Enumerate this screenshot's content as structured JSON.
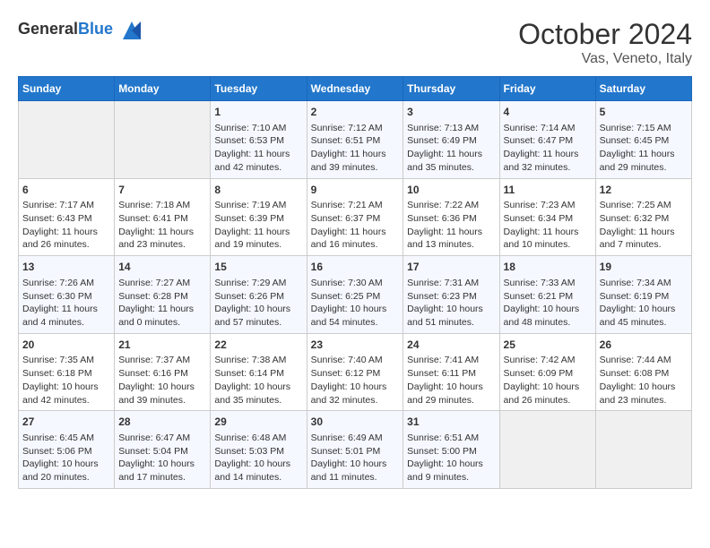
{
  "header": {
    "logo_general": "General",
    "logo_blue": "Blue",
    "month": "October 2024",
    "location": "Vas, Veneto, Italy"
  },
  "weekdays": [
    "Sunday",
    "Monday",
    "Tuesday",
    "Wednesday",
    "Thursday",
    "Friday",
    "Saturday"
  ],
  "weeks": [
    [
      {
        "day": "",
        "sunrise": "",
        "sunset": "",
        "daylight": ""
      },
      {
        "day": "",
        "sunrise": "",
        "sunset": "",
        "daylight": ""
      },
      {
        "day": "1",
        "sunrise": "Sunrise: 7:10 AM",
        "sunset": "Sunset: 6:53 PM",
        "daylight": "Daylight: 11 hours and 42 minutes."
      },
      {
        "day": "2",
        "sunrise": "Sunrise: 7:12 AM",
        "sunset": "Sunset: 6:51 PM",
        "daylight": "Daylight: 11 hours and 39 minutes."
      },
      {
        "day": "3",
        "sunrise": "Sunrise: 7:13 AM",
        "sunset": "Sunset: 6:49 PM",
        "daylight": "Daylight: 11 hours and 35 minutes."
      },
      {
        "day": "4",
        "sunrise": "Sunrise: 7:14 AM",
        "sunset": "Sunset: 6:47 PM",
        "daylight": "Daylight: 11 hours and 32 minutes."
      },
      {
        "day": "5",
        "sunrise": "Sunrise: 7:15 AM",
        "sunset": "Sunset: 6:45 PM",
        "daylight": "Daylight: 11 hours and 29 minutes."
      }
    ],
    [
      {
        "day": "6",
        "sunrise": "Sunrise: 7:17 AM",
        "sunset": "Sunset: 6:43 PM",
        "daylight": "Daylight: 11 hours and 26 minutes."
      },
      {
        "day": "7",
        "sunrise": "Sunrise: 7:18 AM",
        "sunset": "Sunset: 6:41 PM",
        "daylight": "Daylight: 11 hours and 23 minutes."
      },
      {
        "day": "8",
        "sunrise": "Sunrise: 7:19 AM",
        "sunset": "Sunset: 6:39 PM",
        "daylight": "Daylight: 11 hours and 19 minutes."
      },
      {
        "day": "9",
        "sunrise": "Sunrise: 7:21 AM",
        "sunset": "Sunset: 6:37 PM",
        "daylight": "Daylight: 11 hours and 16 minutes."
      },
      {
        "day": "10",
        "sunrise": "Sunrise: 7:22 AM",
        "sunset": "Sunset: 6:36 PM",
        "daylight": "Daylight: 11 hours and 13 minutes."
      },
      {
        "day": "11",
        "sunrise": "Sunrise: 7:23 AM",
        "sunset": "Sunset: 6:34 PM",
        "daylight": "Daylight: 11 hours and 10 minutes."
      },
      {
        "day": "12",
        "sunrise": "Sunrise: 7:25 AM",
        "sunset": "Sunset: 6:32 PM",
        "daylight": "Daylight: 11 hours and 7 minutes."
      }
    ],
    [
      {
        "day": "13",
        "sunrise": "Sunrise: 7:26 AM",
        "sunset": "Sunset: 6:30 PM",
        "daylight": "Daylight: 11 hours and 4 minutes."
      },
      {
        "day": "14",
        "sunrise": "Sunrise: 7:27 AM",
        "sunset": "Sunset: 6:28 PM",
        "daylight": "Daylight: 11 hours and 0 minutes."
      },
      {
        "day": "15",
        "sunrise": "Sunrise: 7:29 AM",
        "sunset": "Sunset: 6:26 PM",
        "daylight": "Daylight: 10 hours and 57 minutes."
      },
      {
        "day": "16",
        "sunrise": "Sunrise: 7:30 AM",
        "sunset": "Sunset: 6:25 PM",
        "daylight": "Daylight: 10 hours and 54 minutes."
      },
      {
        "day": "17",
        "sunrise": "Sunrise: 7:31 AM",
        "sunset": "Sunset: 6:23 PM",
        "daylight": "Daylight: 10 hours and 51 minutes."
      },
      {
        "day": "18",
        "sunrise": "Sunrise: 7:33 AM",
        "sunset": "Sunset: 6:21 PM",
        "daylight": "Daylight: 10 hours and 48 minutes."
      },
      {
        "day": "19",
        "sunrise": "Sunrise: 7:34 AM",
        "sunset": "Sunset: 6:19 PM",
        "daylight": "Daylight: 10 hours and 45 minutes."
      }
    ],
    [
      {
        "day": "20",
        "sunrise": "Sunrise: 7:35 AM",
        "sunset": "Sunset: 6:18 PM",
        "daylight": "Daylight: 10 hours and 42 minutes."
      },
      {
        "day": "21",
        "sunrise": "Sunrise: 7:37 AM",
        "sunset": "Sunset: 6:16 PM",
        "daylight": "Daylight: 10 hours and 39 minutes."
      },
      {
        "day": "22",
        "sunrise": "Sunrise: 7:38 AM",
        "sunset": "Sunset: 6:14 PM",
        "daylight": "Daylight: 10 hours and 35 minutes."
      },
      {
        "day": "23",
        "sunrise": "Sunrise: 7:40 AM",
        "sunset": "Sunset: 6:12 PM",
        "daylight": "Daylight: 10 hours and 32 minutes."
      },
      {
        "day": "24",
        "sunrise": "Sunrise: 7:41 AM",
        "sunset": "Sunset: 6:11 PM",
        "daylight": "Daylight: 10 hours and 29 minutes."
      },
      {
        "day": "25",
        "sunrise": "Sunrise: 7:42 AM",
        "sunset": "Sunset: 6:09 PM",
        "daylight": "Daylight: 10 hours and 26 minutes."
      },
      {
        "day": "26",
        "sunrise": "Sunrise: 7:44 AM",
        "sunset": "Sunset: 6:08 PM",
        "daylight": "Daylight: 10 hours and 23 minutes."
      }
    ],
    [
      {
        "day": "27",
        "sunrise": "Sunrise: 6:45 AM",
        "sunset": "Sunset: 5:06 PM",
        "daylight": "Daylight: 10 hours and 20 minutes."
      },
      {
        "day": "28",
        "sunrise": "Sunrise: 6:47 AM",
        "sunset": "Sunset: 5:04 PM",
        "daylight": "Daylight: 10 hours and 17 minutes."
      },
      {
        "day": "29",
        "sunrise": "Sunrise: 6:48 AM",
        "sunset": "Sunset: 5:03 PM",
        "daylight": "Daylight: 10 hours and 14 minutes."
      },
      {
        "day": "30",
        "sunrise": "Sunrise: 6:49 AM",
        "sunset": "Sunset: 5:01 PM",
        "daylight": "Daylight: 10 hours and 11 minutes."
      },
      {
        "day": "31",
        "sunrise": "Sunrise: 6:51 AM",
        "sunset": "Sunset: 5:00 PM",
        "daylight": "Daylight: 10 hours and 9 minutes."
      },
      {
        "day": "",
        "sunrise": "",
        "sunset": "",
        "daylight": ""
      },
      {
        "day": "",
        "sunrise": "",
        "sunset": "",
        "daylight": ""
      }
    ]
  ]
}
